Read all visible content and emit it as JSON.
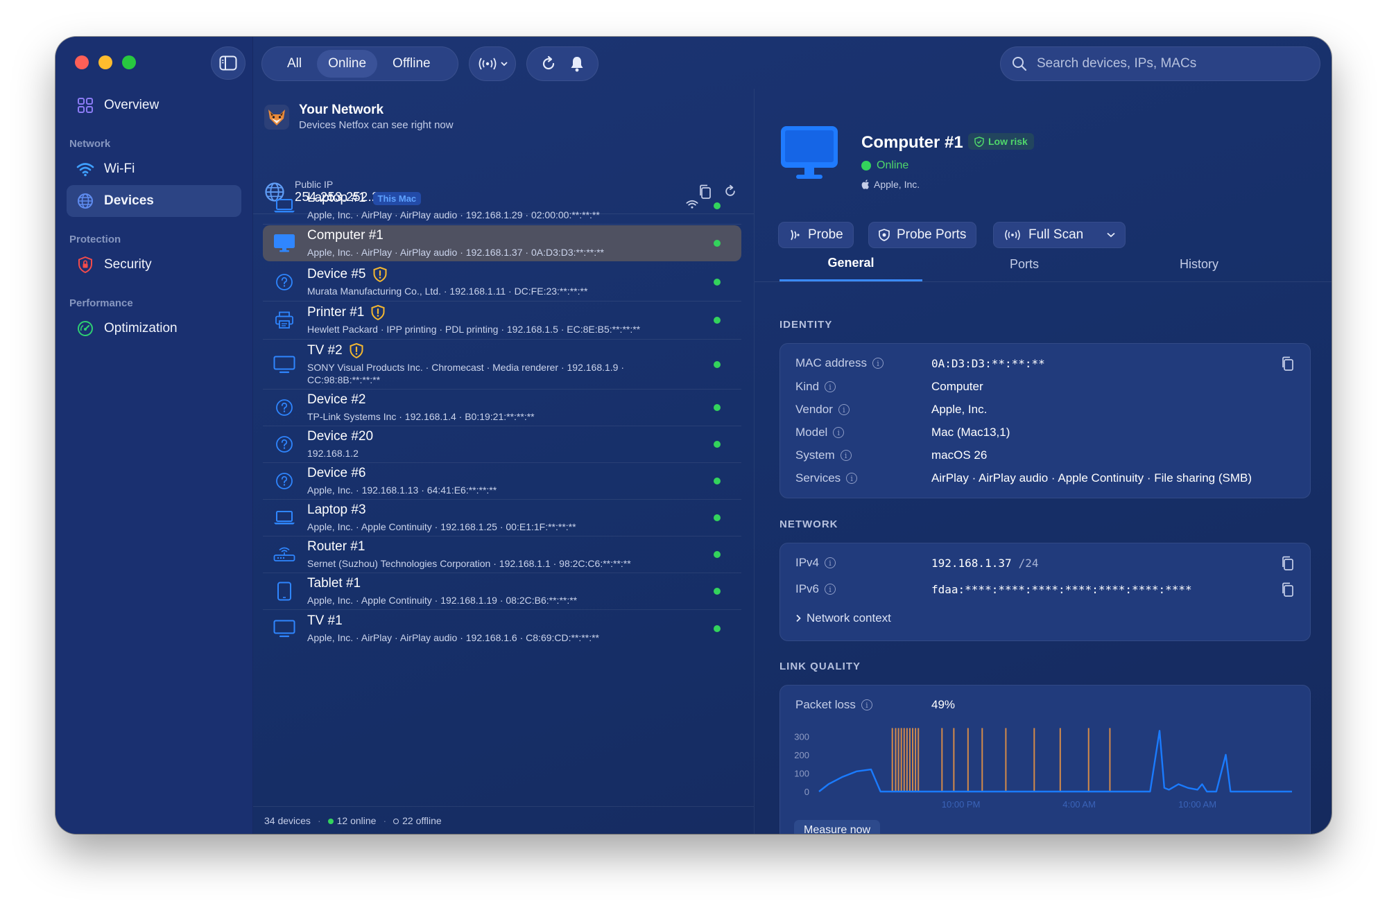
{
  "toolbar": {
    "filters": [
      "All",
      "Online",
      "Offline"
    ],
    "active_filter": "Online",
    "search_placeholder": "Search devices, IPs, MACs"
  },
  "sidebar": {
    "overview": "Overview",
    "sections": {
      "network": "Network",
      "protection": "Protection",
      "performance": "Performance"
    },
    "items": {
      "wifi": "Wi-Fi",
      "devices": "Devices",
      "security": "Security",
      "optimization": "Optimization"
    }
  },
  "network": {
    "title": "Your Network",
    "subtitle": "Devices Netfox can see right now",
    "public_ip_label": "Public IP",
    "public_ip": "254.253.252.251"
  },
  "devices": [
    {
      "name": "Laptop #1",
      "badge": "This Mac",
      "meta": "Apple, Inc. · AirPlay · AirPlay audio · 192.168.1.29 · 02:00:00:**:**:**",
      "icon": "laptop-icon",
      "warn": false,
      "wifi": true
    },
    {
      "name": "Computer #1",
      "meta": "Apple, Inc. · AirPlay · AirPlay audio · 192.168.1.37 · 0A:D3:D3:**:**:**",
      "icon": "monitor-icon",
      "warn": false,
      "selected": true
    },
    {
      "name": "Device #5",
      "meta": "Murata Manufacturing Co., Ltd. · 192.168.1.11 · DC:FE:23:**:**:**",
      "icon": "question-icon",
      "warn": true
    },
    {
      "name": "Printer #1",
      "meta": "Hewlett Packard · IPP printing · PDL printing · 192.168.1.5 · EC:8E:B5:**:**:**",
      "icon": "printer-icon",
      "warn": true
    },
    {
      "name": "TV #2",
      "meta": "SONY Visual Products Inc. · Chromecast · Media renderer · 192.168.1.9 ·",
      "meta2": "CC:98:8B:**:**:**",
      "icon": "tv-icon",
      "warn": true
    },
    {
      "name": "Device #2",
      "meta": "TP-Link Systems Inc · 192.168.1.4 · B0:19:21:**:**:**",
      "icon": "question-icon",
      "warn": false
    },
    {
      "name": "Device #20",
      "meta": "192.168.1.2",
      "icon": "question-icon",
      "warn": false
    },
    {
      "name": "Device #6",
      "meta": "Apple, Inc. · 192.168.1.13 · 64:41:E6:**:**:**",
      "icon": "question-icon",
      "warn": false
    },
    {
      "name": "Laptop #3",
      "meta": "Apple, Inc. · Apple Continuity · 192.168.1.25 · 00:E1:1F:**:**:**",
      "icon": "laptop-icon",
      "warn": false
    },
    {
      "name": "Router #1",
      "meta": "Sernet (Suzhou) Technologies Corporation · 192.168.1.1 · 98:2C:C6:**:**:**",
      "icon": "router-icon",
      "warn": false
    },
    {
      "name": "Tablet #1",
      "meta": "Apple, Inc. · Apple Continuity · 192.168.1.19 · 08:2C:B6:**:**:**",
      "icon": "tablet-icon",
      "warn": false
    },
    {
      "name": "TV #1",
      "meta": "Apple, Inc. · AirPlay · AirPlay audio · 192.168.1.6 · C8:69:CD:**:**:**",
      "icon": "tv-icon",
      "warn": false
    }
  ],
  "footer": {
    "total": "34 devices",
    "online": "12 online",
    "offline": "22 offline"
  },
  "detail": {
    "name": "Computer #1",
    "risk": "Low risk",
    "status": "Online",
    "vendor": "Apple, Inc.",
    "actions": {
      "probe": "Probe",
      "probe_ports": "Probe Ports",
      "full_scan": "Full Scan"
    },
    "tabs": [
      "General",
      "Ports",
      "History"
    ],
    "active_tab": "General",
    "identity_title": "IDENTITY",
    "identity": {
      "mac_label": "MAC address",
      "mac": "0A:D3:D3:**:**:**",
      "kind_label": "Kind",
      "kind": "Computer",
      "vendor_label": "Vendor",
      "vendor": "Apple, Inc.",
      "model_label": "Model",
      "model": "Mac (Mac13,1)",
      "system_label": "System",
      "system": "macOS 26",
      "services_label": "Services",
      "services": "AirPlay · AirPlay audio · Apple Continuity · File sharing (SMB)"
    },
    "network_title": "NETWORK",
    "network": {
      "ipv4_label": "IPv4",
      "ipv4": "192.168.1.37",
      "ipv4_prefix": "/24",
      "ipv6_label": "IPv6",
      "ipv6": "fdaa:****:****:****:****:****:****:****",
      "context": "Network context"
    },
    "link_title": "LINK QUALITY",
    "link": {
      "packet_loss_label": "Packet loss",
      "packet_loss": "49%",
      "measure": "Measure now"
    }
  },
  "chart_data": {
    "type": "line",
    "title": "",
    "ylim": [
      0,
      350
    ],
    "yticks": [
      "300",
      "200",
      "100",
      "0"
    ],
    "xticks": [
      "10:00 PM",
      "4:00 AM",
      "10:00 AM"
    ],
    "latency_series": {
      "name": "",
      "x": [
        0,
        2,
        5,
        8,
        11,
        13,
        14,
        15,
        20,
        30,
        40,
        50,
        60,
        70,
        72,
        73,
        74,
        76,
        78,
        80,
        81,
        82,
        84,
        86,
        87,
        88,
        89,
        90,
        100
      ],
      "values": [
        0,
        40,
        80,
        110,
        120,
        0,
        0,
        0,
        0,
        0,
        0,
        0,
        0,
        0,
        330,
        20,
        10,
        40,
        20,
        10,
        40,
        0,
        0,
        200,
        0,
        0,
        0,
        0,
        0
      ]
    },
    "loss_markers_x": [
      15.5,
      16.2,
      16.8,
      17.4,
      18.0,
      18.6,
      19.2,
      19.8,
      20.4,
      21.0,
      26.0,
      28.5,
      31.5,
      34.5,
      39.5,
      45.5,
      51.0,
      57.0,
      61.5
    ],
    "colors": {
      "latency": "#1a7bff",
      "loss": "#d38a4a"
    }
  }
}
